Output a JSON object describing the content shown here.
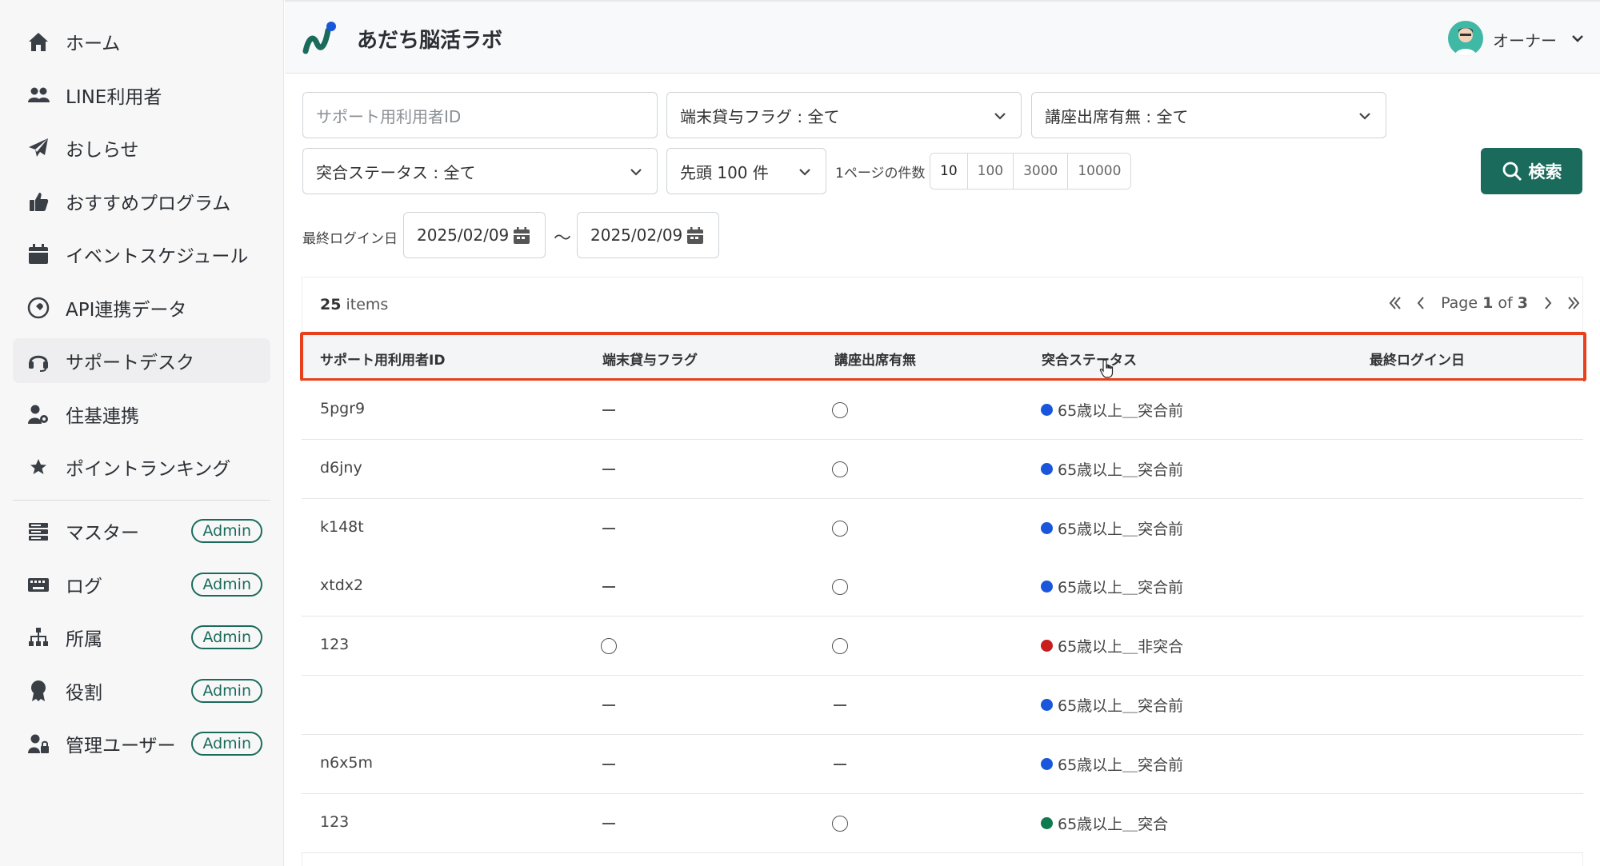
{
  "app": {
    "title": "あだち脳活ラボ"
  },
  "user": {
    "name": "オーナー"
  },
  "sidebar": {
    "items": [
      {
        "label": "ホーム",
        "icon": "home-icon"
      },
      {
        "label": "LINE利用者",
        "icon": "users-icon"
      },
      {
        "label": "おしらせ",
        "icon": "paper-plane-icon"
      },
      {
        "label": "おすすめプログラム",
        "icon": "thumbs-up-icon"
      },
      {
        "label": "イベントスケジュール",
        "icon": "calendar-icon"
      },
      {
        "label": "API連携データ",
        "icon": "plug-icon"
      },
      {
        "label": "サポートデスク",
        "icon": "headset-icon",
        "active": true
      },
      {
        "label": "住基連携",
        "icon": "user-gear-icon"
      },
      {
        "label": "ポイントランキング",
        "icon": "star-icon"
      }
    ],
    "admin_items": [
      {
        "label": "マスター",
        "badge": "Admin",
        "icon": "server-icon"
      },
      {
        "label": "ログ",
        "badge": "Admin",
        "icon": "keyboard-icon"
      },
      {
        "label": "所属",
        "badge": "Admin",
        "icon": "sitemap-icon"
      },
      {
        "label": "役割",
        "badge": "Admin",
        "icon": "award-icon"
      },
      {
        "label": "管理ユーザー",
        "badge": "Admin",
        "icon": "user-lock-icon"
      }
    ]
  },
  "filters": {
    "support_id_placeholder": "サポート用利用者ID",
    "device_flag": "端末貸与フラグ : 全て",
    "attendance": "講座出席有無 : 全て",
    "match_status": "突合ステータス : 全て",
    "limit": "先頭 100 件",
    "per_page_label": "1ページの件数",
    "per_page_options": [
      "10",
      "100",
      "3000",
      "10000"
    ],
    "per_page_selected": "10",
    "search_label": "検索",
    "last_login_label": "最終ログイン日",
    "date_from": "2025/02/09",
    "date_to": "2025/02/09",
    "date_separator": "～"
  },
  "table": {
    "count": "25",
    "count_suffix": "items",
    "pager": {
      "page_word": "Page",
      "page": "1",
      "of_word": "of",
      "total": "3"
    },
    "columns": [
      "サポート用利用者ID",
      "端末貸与フラグ",
      "講座出席有無",
      "突合ステータス",
      "最終ログイン日"
    ],
    "rows": [
      {
        "id": "5pgr9",
        "device": "—",
        "attend": "○",
        "status": "65歳以上＿突合前",
        "status_color": "#1a56db"
      },
      {
        "id": "d6jny",
        "device": "—",
        "attend": "○",
        "status": "65歳以上＿突合前",
        "status_color": "#1a56db"
      },
      {
        "id": "k148t",
        "device": "—",
        "attend": "○",
        "status": "65歳以上＿突合前",
        "status_color": "#1a56db"
      },
      {
        "id": "xtdx2",
        "device": "—",
        "attend": "○",
        "status": "65歳以上＿突合前",
        "status_color": "#1a56db"
      },
      {
        "id": "123",
        "device": "○",
        "attend": "○",
        "status": "65歳以上＿非突合",
        "status_color": "#c81e1e"
      },
      {
        "id": "",
        "device": "—",
        "attend": "—",
        "status": "65歳以上＿突合前",
        "status_color": "#1a56db"
      },
      {
        "id": "n6x5m",
        "device": "—",
        "attend": "—",
        "status": "65歳以上＿突合前",
        "status_color": "#1a56db"
      },
      {
        "id": "123",
        "device": "—",
        "attend": "○",
        "status": "65歳以上＿突合",
        "status_color": "#0e7a4f"
      }
    ]
  },
  "colors": {
    "accent": "#1b6b5c",
    "highlight": "#e8401c"
  }
}
